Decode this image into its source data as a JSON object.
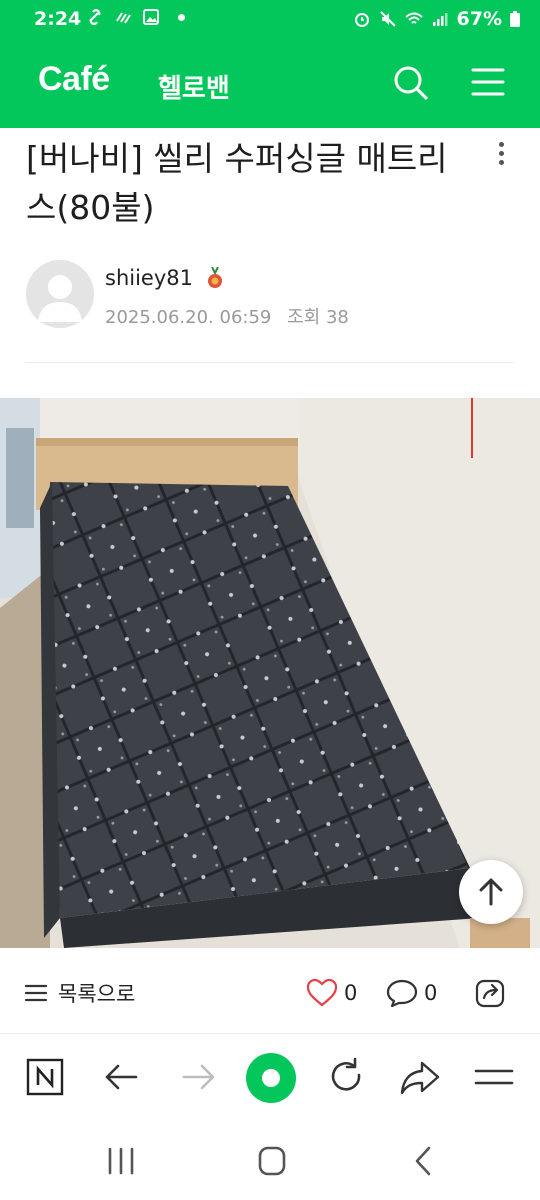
{
  "status_bar": {
    "time": "2:24",
    "battery": "67%"
  },
  "header": {
    "logo": "Café",
    "cafe_name": "헬로밴",
    "icons": [
      "search-icon",
      "menu-icon"
    ]
  },
  "post": {
    "title": "[버나비] 씰리 수퍼싱글 매트리스(80불)",
    "author": "shiiey81",
    "date": "2025.06.20. 06:59",
    "views_label": "조회",
    "views": "38"
  },
  "actions": {
    "list_label": "목록으로",
    "likes": "0",
    "comments": "0"
  },
  "colors": {
    "brand_green": "#03c75a",
    "like_red": "#e5414b"
  }
}
